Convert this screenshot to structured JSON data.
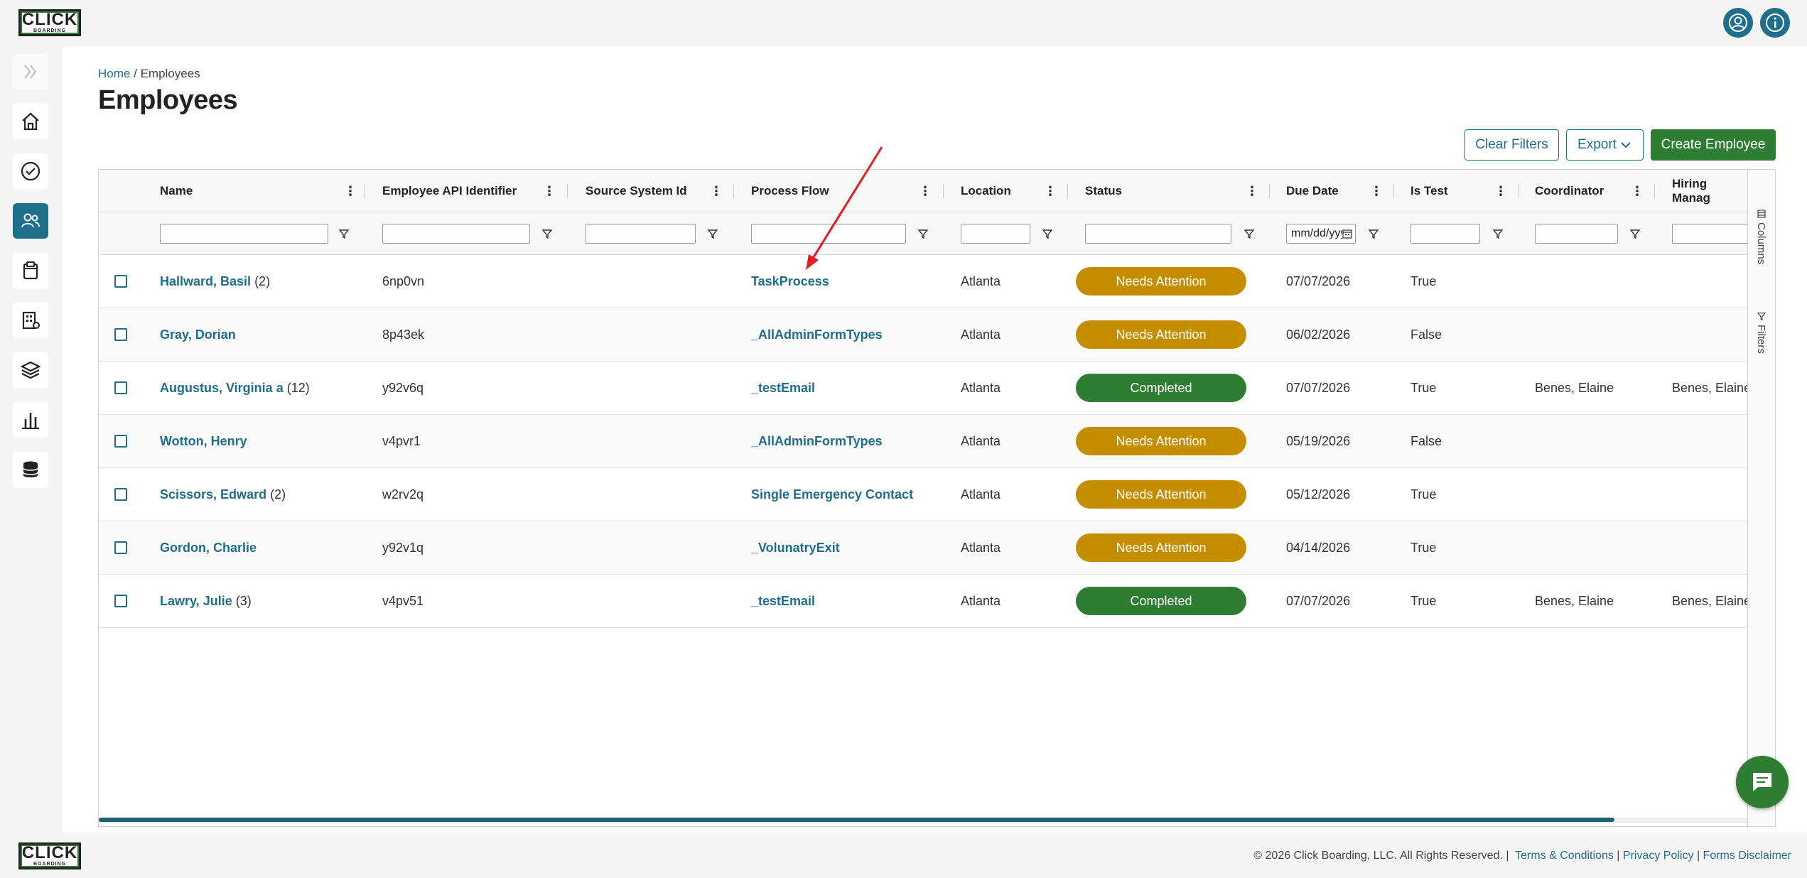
{
  "app": {
    "logo_text": "CLICK",
    "logo_subtext": "BOARDING"
  },
  "topbar": {
    "icons": [
      "user-circle-icon",
      "info-icon"
    ]
  },
  "sidebar": {
    "items": [
      "expand-icon",
      "home-icon",
      "check-circle-icon",
      "people-icon",
      "clipboard-icon",
      "building-settings-icon",
      "layers-icon",
      "bar-chart-icon",
      "database-icon"
    ],
    "active": "people-icon"
  },
  "breadcrumb": {
    "home": "Home",
    "separator": "/",
    "current": "Employees"
  },
  "page": {
    "title": "Employees"
  },
  "actions": {
    "clear_filters": "Clear Filters",
    "export": "Export",
    "create": "Create Employee"
  },
  "columns": [
    "Name",
    "Employee API Identifier",
    "Source System Id",
    "Process Flow",
    "Location",
    "Status",
    "Due Date",
    "Is Test",
    "Coordinator",
    "Hiring Manag"
  ],
  "filters": {
    "due_date_placeholder": "mm/dd/yyyy"
  },
  "rows": [
    {
      "name": "Hallward, Basil",
      "count": "(2)",
      "api_id": "6np0vn",
      "source_id": "",
      "process": "TaskProcess",
      "location": "Atlanta",
      "status": "Needs Attention",
      "due": "07/07/2026",
      "is_test": "True",
      "coordinator": "",
      "hiring_manager": ""
    },
    {
      "name": "Gray, Dorian",
      "count": "",
      "api_id": "8p43ek",
      "source_id": "",
      "process": "_AllAdminFormTypes",
      "location": "Atlanta",
      "status": "Needs Attention",
      "due": "06/02/2026",
      "is_test": "False",
      "coordinator": "",
      "hiring_manager": ""
    },
    {
      "name": "Augustus, Virginia a",
      "count": "(12)",
      "api_id": "y92v6q",
      "source_id": "",
      "process": "_testEmail",
      "location": "Atlanta",
      "status": "Completed",
      "due": "07/07/2026",
      "is_test": "True",
      "coordinator": "Benes, Elaine",
      "hiring_manager": "Benes, Elaine"
    },
    {
      "name": "Wotton, Henry",
      "count": "",
      "api_id": "v4pvr1",
      "source_id": "",
      "process": "_AllAdminFormTypes",
      "location": "Atlanta",
      "status": "Needs Attention",
      "due": "05/19/2026",
      "is_test": "False",
      "coordinator": "",
      "hiring_manager": ""
    },
    {
      "name": "Scissors, Edward",
      "count": "(2)",
      "api_id": "w2rv2q",
      "source_id": "",
      "process": "Single Emergency Contact",
      "location": "Atlanta",
      "status": "Needs Attention",
      "due": "05/12/2026",
      "is_test": "True",
      "coordinator": "",
      "hiring_manager": ""
    },
    {
      "name": "Gordon, Charlie",
      "count": "",
      "api_id": "y92v1q",
      "source_id": "",
      "process": "_VolunatryExit",
      "location": "Atlanta",
      "status": "Needs Attention",
      "due": "04/14/2026",
      "is_test": "True",
      "coordinator": "",
      "hiring_manager": ""
    },
    {
      "name": "Lawry, Julie",
      "count": "(3)",
      "api_id": "v4pv51",
      "source_id": "",
      "process": "_testEmail",
      "location": "Atlanta",
      "status": "Completed",
      "due": "07/07/2026",
      "is_test": "True",
      "coordinator": "Benes, Elaine",
      "hiring_manager": "Benes, Elaine"
    }
  ],
  "status_colors": {
    "Needs Attention": "#c58e00",
    "Completed": "#2e7d32"
  },
  "grid_side": {
    "columns": "Columns",
    "filters": "Filters"
  },
  "footer": {
    "copyright": "© 2026 Click Boarding, LLC. All Rights Reserved.",
    "sep": "|",
    "terms": "Terms & Conditions",
    "privacy": "Privacy Policy",
    "disclaimer": "Forms Disclaimer"
  }
}
